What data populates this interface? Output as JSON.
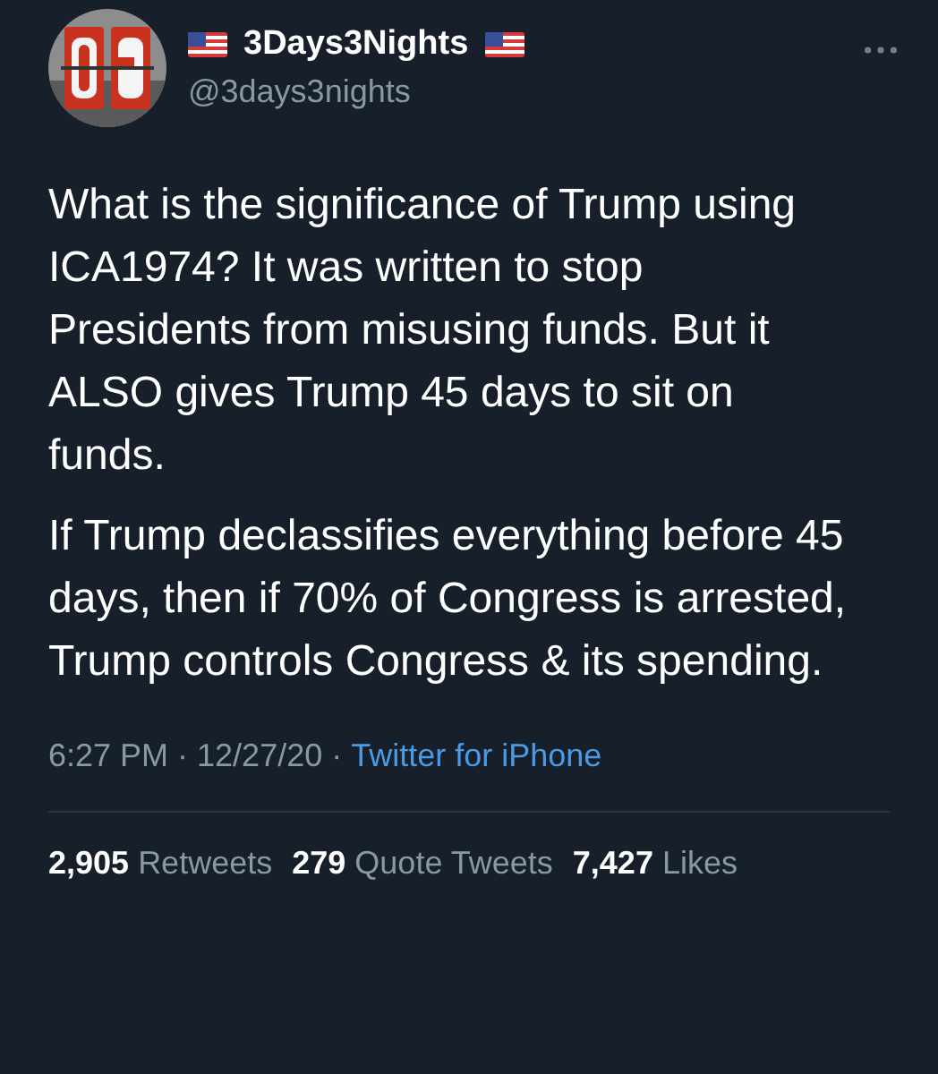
{
  "author": {
    "display_name": "3Days3Nights",
    "handle": "@3days3nights"
  },
  "paragraphs": [
    "What is the significance of Trump using ICA1974? It was written to stop Presidents from misusing funds. But it ALSO gives Trump 45 days to sit on funds.",
    "If Trump declassifies everything before 45 days, then if 70% of Congress is arrested, Trump controls Congress & its spending."
  ],
  "meta": {
    "timestamp": "6:27 PM · 12/27/20 ·",
    "source": "Twitter for iPhone"
  },
  "stats": [
    {
      "count": "2,905",
      "label": "Retweets"
    },
    {
      "count": "279",
      "label": "Quote Tweets"
    },
    {
      "count": "7,427",
      "label": "Likes"
    }
  ]
}
